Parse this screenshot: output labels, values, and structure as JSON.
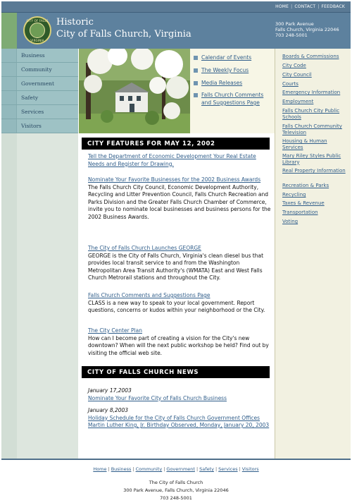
{
  "top_links": [
    "HOME",
    "CONTACT",
    "FEEDBACK"
  ],
  "header": {
    "title_line1": "Historic",
    "title_line2": "City of Falls Church, Virginia",
    "address_line1": "300 Park Avenue",
    "address_line2": "Falls Church, Virginia 22046",
    "phone": "703 248-5001",
    "seal_top": "CITY OF FALLS",
    "seal_bottom": "VIRGINIA"
  },
  "left_nav": [
    "Business",
    "Community",
    "Government",
    "Safety",
    "Services",
    "Visitors"
  ],
  "quick_links": [
    "Calendar of Events",
    "The Weekly Focus",
    "Media Releases",
    "Falls Church Comments and Suggestions Page"
  ],
  "features": {
    "heading": "CITY FEATURES FOR MAY 12, 2002",
    "items": [
      {
        "link": "Tell the Department of Economic Development Your Real Estate Needs and Register for Drawing.",
        "desc": ""
      },
      {
        "link": "Nominate Your Favorite Businesses for the 2002 Business Awards",
        "desc": "The Falls Church City Council, Economic Development Authority, Recycling and Litter Prevention Council, Falls Church Recreation and Parks Division and the Greater Falls Church Chamber of Commerce, invite you to nominate local businesses and business persons for the 2002 Business Awards."
      },
      {
        "link": "The City of Falls Church Launches GEORGE",
        "desc": "GEORGE is the City of Falls Church, Virginia's clean diesel bus that provides local transit service to and from the Washington Metropolitan Area Transit Authority's (WMATA) East and West Falls Church Metrorail stations and throughout the City."
      },
      {
        "link": "Falls Church Comments and Suggestions Page",
        "desc": "CLASS is a new way to speak to your local government. Report questions, concerns or kudos within your neighborhood or the City."
      },
      {
        "link": "The City Center Plan",
        "desc": "How can I become part of creating a vision for the City's new downtown? When will the next public workshop be held? Find out by visiting the official web site."
      }
    ]
  },
  "news": {
    "heading": "CITY OF FALLS CHURCH NEWS",
    "items": [
      {
        "date": "January 17,2003",
        "links": [
          "Nominate Your Favorite City of Falls Church Business"
        ]
      },
      {
        "date": "January 8,2003",
        "links": [
          "Holiday Schedule for the City of Falls Church Government Offices",
          "Martin Luther King, Jr. Birthday Observed, Monday, January 20, 2003"
        ]
      }
    ]
  },
  "right_links": [
    "Boards & Commissions",
    "City Code",
    "City Council",
    "Courts",
    "Emergency Information",
    "Employment",
    "Falls Church City Public Schools",
    "Falls Church Community Television",
    "Housing & Human Services",
    "Mary Riley Styles Public Library",
    "Real Property Information",
    "Recreation & Parks",
    "Recycling",
    "Taxes & Revenue",
    "Transportation",
    "Voting"
  ],
  "footer": {
    "links": [
      "Home",
      "Business",
      "Community",
      "Government",
      "Safety",
      "Services",
      "Visitors"
    ],
    "separator": "|",
    "name": "The City of Falls Church",
    "address": "300 Park Avenue, Falls Church, Virginia 22046",
    "phone": "703 248-5001"
  },
  "colors": {
    "header_blue": "#5d819e",
    "nav_teal": "#9ec2c5",
    "sidebar_cream": "#f2f1e1",
    "link_blue": "#2f5d8a",
    "banner_black": "#000000"
  }
}
